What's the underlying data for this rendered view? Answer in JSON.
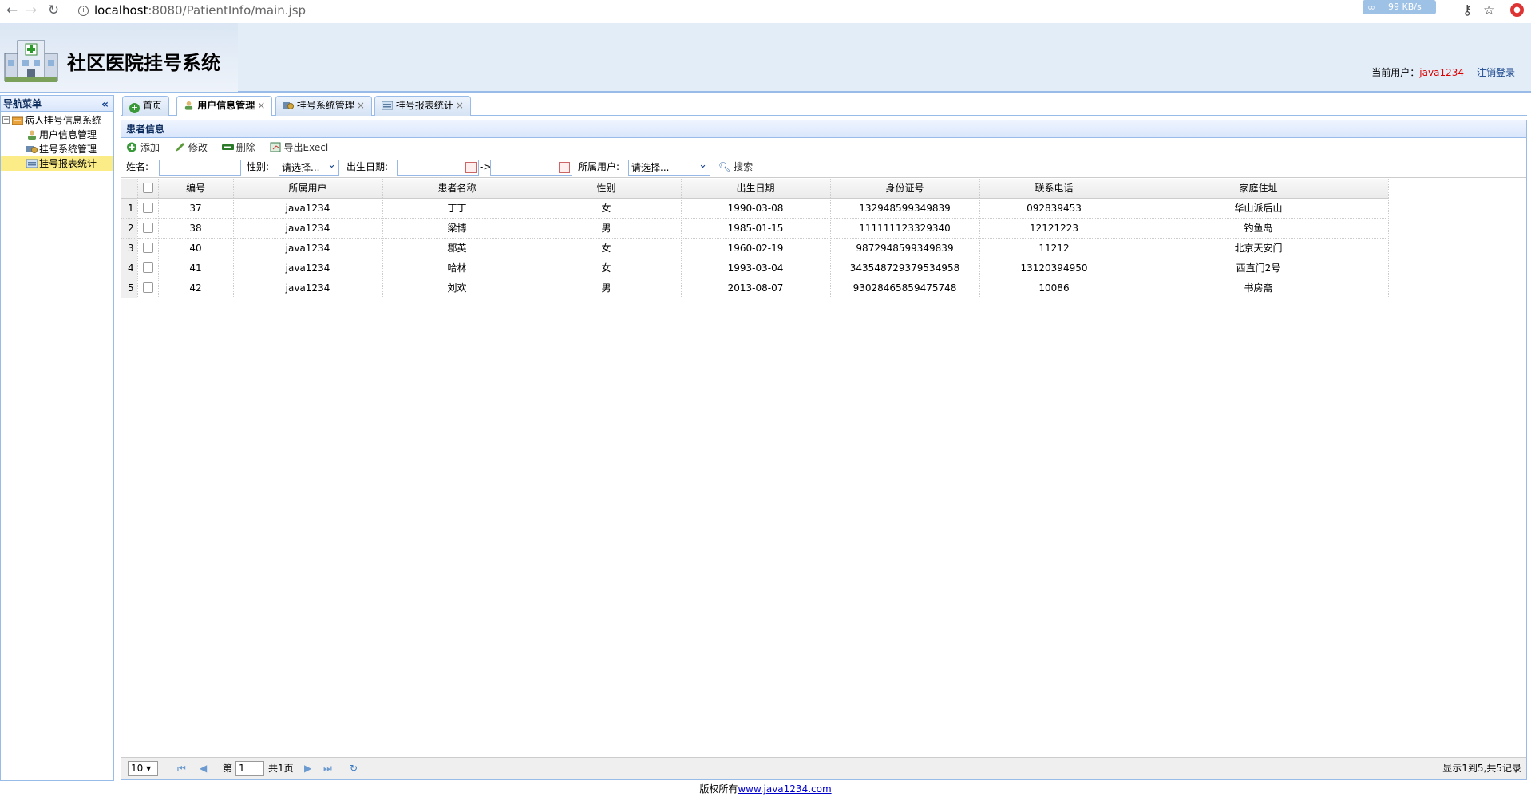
{
  "browser": {
    "url_host": "localhost",
    "url_rest": ":8080/PatientInfo/main.jsp",
    "ext_speed": "99 KB/s"
  },
  "header": {
    "title": "社区医院挂号系统",
    "current_user_label": "当前用户：",
    "current_user": "java1234",
    "logout": "注销登录"
  },
  "sidebar": {
    "title": "导航菜单",
    "root": "病人挂号信息系统",
    "items": [
      "用户信息管理",
      "挂号系统管理",
      "挂号报表统计"
    ]
  },
  "tabs": [
    {
      "label": "首页",
      "closable": false
    },
    {
      "label": "用户信息管理",
      "closable": true
    },
    {
      "label": "挂号系统管理",
      "closable": true
    },
    {
      "label": "挂号报表统计",
      "closable": true
    }
  ],
  "panel": {
    "title": "患者信息",
    "toolbar": {
      "add": "添加",
      "edit": "修改",
      "delete": "删除",
      "export": "导出Execl"
    },
    "search": {
      "name_label": "姓名:",
      "gender_label": "性别:",
      "gender_value": "请选择...",
      "birth_label": "出生日期:",
      "range_sep": "->",
      "user_label": "所属用户:",
      "user_value": "请选择...",
      "search_btn": "搜索"
    },
    "columns": [
      "编号",
      "所属用户",
      "患者名称",
      "性别",
      "出生日期",
      "身份证号",
      "联系电话",
      "家庭住址"
    ],
    "rows": [
      [
        "1",
        "37",
        "java1234",
        "丁丁",
        "女",
        "1990-03-08",
        "132948599349839",
        "092839453",
        "华山派后山"
      ],
      [
        "2",
        "38",
        "java1234",
        "梁博",
        "男",
        "1985-01-15",
        "111111123329340",
        "12121223",
        "钓鱼岛"
      ],
      [
        "3",
        "40",
        "java1234",
        "郡英",
        "女",
        "1960-02-19",
        "9872948599349839",
        "11212",
        "北京天安门"
      ],
      [
        "4",
        "41",
        "java1234",
        "哈林",
        "女",
        "1993-03-04",
        "343548729379534958",
        "13120394950",
        "西直门2号"
      ],
      [
        "5",
        "42",
        "java1234",
        "刘欢",
        "男",
        "2013-08-07",
        "93028465859475748",
        "10086",
        "书房斋"
      ]
    ],
    "pager": {
      "page_size": "10 ▾",
      "page_prefix": "第",
      "page_value": "1",
      "page_total": "共1页",
      "info": "显示1到5,共5记录"
    }
  },
  "footer": {
    "text": "版权所有",
    "link": "www.java1234.com"
  }
}
